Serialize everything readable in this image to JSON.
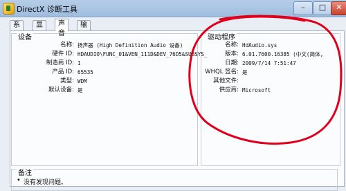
{
  "window": {
    "title": "DirectX 诊断工具",
    "buttons": {
      "minimize": "–",
      "maximize": "□",
      "close": "✕"
    }
  },
  "tabs": [
    {
      "label": "系统"
    },
    {
      "label": "显示"
    },
    {
      "label": "声音"
    },
    {
      "label": "输入"
    }
  ],
  "devices": {
    "title": "设备",
    "rows": [
      {
        "label": "名称:",
        "value": "扬声器 (High Definition Audio 设备)"
      },
      {
        "label": "硬件 ID:",
        "value": "HDAUDIO\\FUNC_01&VEN_111D&DEV_76D5&SUBSYS_"
      },
      {
        "label": "制造商 ID:",
        "value": "1"
      },
      {
        "label": "产品 ID:",
        "value": "65535"
      },
      {
        "label": "类型:",
        "value": "WDM"
      },
      {
        "label": "默认设备:",
        "value": "是"
      }
    ]
  },
  "driver": {
    "title": "驱动程序",
    "rows": [
      {
        "label": "名称:",
        "value": "HdAudio.sys"
      },
      {
        "label": "版本:",
        "value": "6.01.7600.16385 (中文(简体,"
      },
      {
        "label": "日期:",
        "value": "2009/7/14 7:51:47"
      },
      {
        "label": "WHQL 签名:",
        "value": "是"
      },
      {
        "label": "其他文件:",
        "value": ""
      },
      {
        "label": "供应商:",
        "value": "Microsoft"
      }
    ]
  },
  "notes": {
    "title": "备注",
    "items": [
      "没有发现问题。"
    ]
  },
  "colors": {
    "annotation": "#e0001b",
    "titlebar": "#9fbddf"
  }
}
